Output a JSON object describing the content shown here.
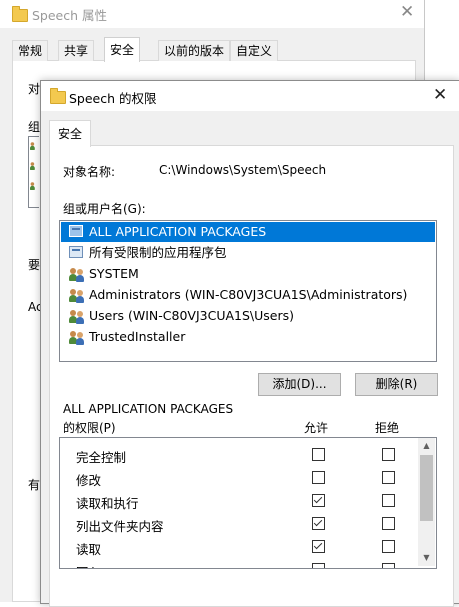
{
  "background_window": {
    "title": "Speech 属性",
    "close_glyph": "✕",
    "tabs": [
      {
        "label": "常规"
      },
      {
        "label": "共享"
      },
      {
        "label": "安全"
      },
      {
        "label": "以前的版本"
      },
      {
        "label": "自定义"
      }
    ],
    "selected_tab": "安全",
    "fragments": [
      "对",
      "组",
      "要",
      "Ac",
      "有"
    ]
  },
  "dialog": {
    "title": "Speech 的权限",
    "close_glyph": "✕",
    "tab": "安全",
    "object_name_label": "对象名称:",
    "object_name_value": "C:\\Windows\\System\\Speech",
    "group_label": "组或用户名(G):",
    "groups": [
      {
        "name": "ALL APPLICATION PACKAGES",
        "icon": "package-icon",
        "selected": true
      },
      {
        "name": "所有受限制的应用程序包",
        "icon": "package-icon",
        "selected": false
      },
      {
        "name": "SYSTEM",
        "icon": "users-icon",
        "selected": false
      },
      {
        "name": "Administrators (WIN-C80VJ3CUA1S\\Administrators)",
        "icon": "users-icon",
        "selected": false
      },
      {
        "name": "Users (WIN-C80VJ3CUA1S\\Users)",
        "icon": "users-icon",
        "selected": false
      },
      {
        "name": "TrustedInstaller",
        "icon": "users-icon",
        "selected": false
      }
    ],
    "add_button": "添加(D)...",
    "remove_button": "删除(R)",
    "perm_for_line1": "ALL APPLICATION PACKAGES",
    "perm_for_line2": "的权限(P)",
    "allow_header": "允许",
    "deny_header": "拒绝",
    "permissions": [
      {
        "name": "完全控制",
        "allow": false,
        "deny": false
      },
      {
        "name": "修改",
        "allow": false,
        "deny": false
      },
      {
        "name": "读取和执行",
        "allow": true,
        "deny": false
      },
      {
        "name": "列出文件夹内容",
        "allow": true,
        "deny": false
      },
      {
        "name": "读取",
        "allow": true,
        "deny": false
      },
      {
        "name": "写入",
        "allow": false,
        "deny": false
      }
    ]
  }
}
